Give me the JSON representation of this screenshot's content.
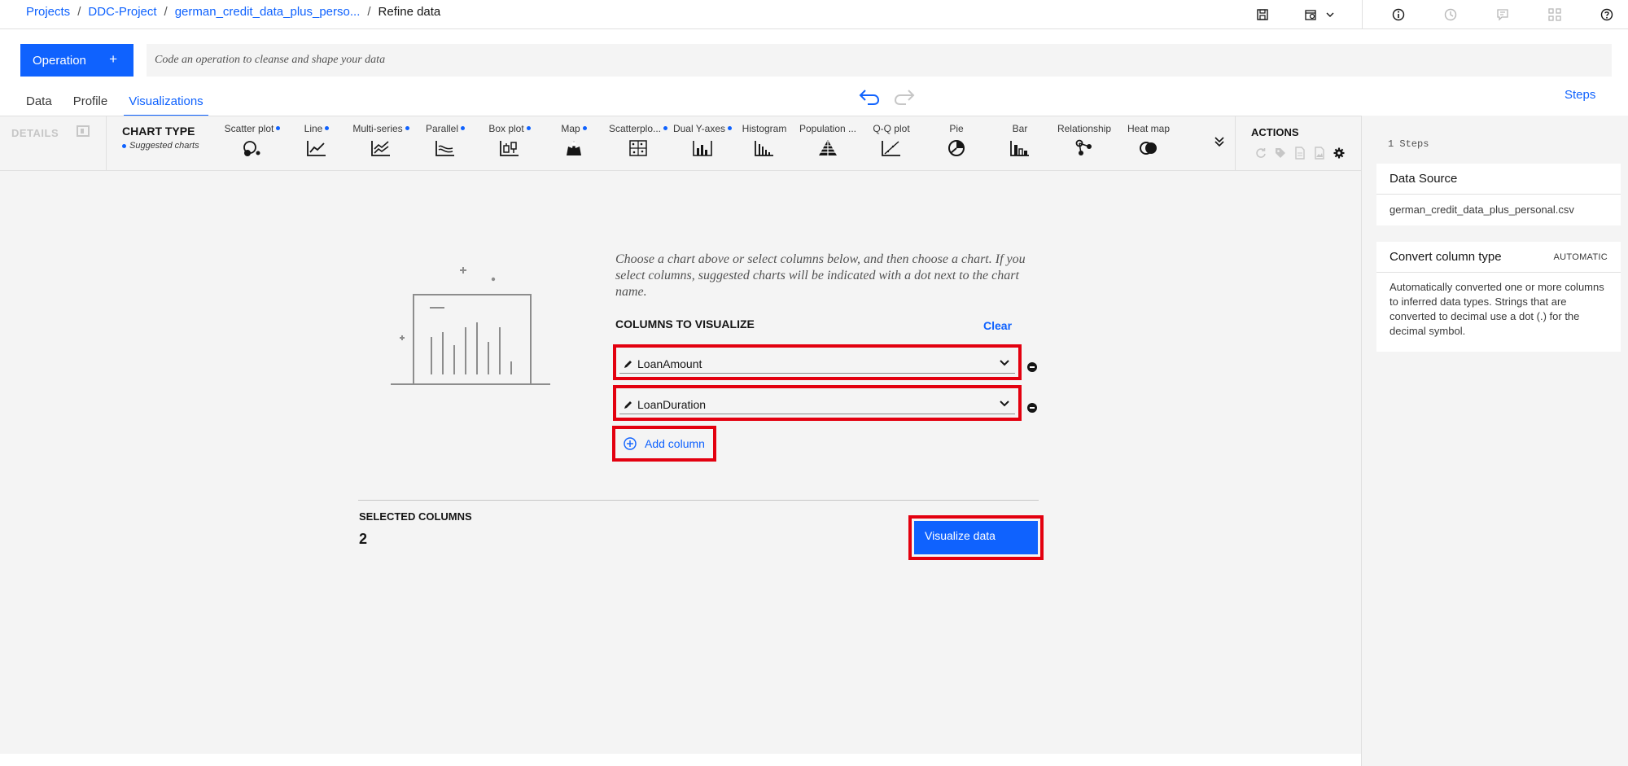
{
  "breadcrumbs": {
    "projects": "Projects",
    "project": "DDC-Project",
    "dataset": "german_credit_data_plus_perso...",
    "current": "Refine data"
  },
  "operation": {
    "button_label": "Operation",
    "plus": "+",
    "code_placeholder": "Code an operation to cleanse and shape your data"
  },
  "tabs": [
    "Data",
    "Profile",
    "Visualizations"
  ],
  "active_tab": "Visualizations",
  "steps_link": "Steps",
  "toolbar": {
    "details_label": "DETAILS",
    "chart_type_title": "CHART TYPE",
    "suggested_label": "Suggested charts",
    "charts": [
      {
        "label": "Scatter plot",
        "suggested": true,
        "icon": "scatter-plot-icon"
      },
      {
        "label": "Line",
        "suggested": true,
        "icon": "line-chart-icon"
      },
      {
        "label": "Multi-series",
        "suggested": true,
        "icon": "multi-series-icon"
      },
      {
        "label": "Parallel",
        "suggested": true,
        "icon": "parallel-icon"
      },
      {
        "label": "Box plot",
        "suggested": true,
        "icon": "box-plot-icon"
      },
      {
        "label": "Map",
        "suggested": true,
        "icon": "map-icon"
      },
      {
        "label": "Scatterplo...",
        "suggested": true,
        "icon": "scatterplot-matrix-icon"
      },
      {
        "label": "Dual Y-axes",
        "suggested": true,
        "icon": "dual-y-axes-icon"
      },
      {
        "label": "Histogram",
        "suggested": false,
        "icon": "histogram-icon"
      },
      {
        "label": "Population ...",
        "suggested": false,
        "icon": "population-pyramid-icon"
      },
      {
        "label": "Q-Q plot",
        "suggested": false,
        "icon": "qq-plot-icon"
      },
      {
        "label": "Pie",
        "suggested": false,
        "icon": "pie-chart-icon"
      },
      {
        "label": "Bar",
        "suggested": false,
        "icon": "bar-chart-icon"
      },
      {
        "label": "Relationship",
        "suggested": false,
        "icon": "relationship-icon"
      },
      {
        "label": "Heat map",
        "suggested": false,
        "icon": "heat-map-icon"
      }
    ],
    "actions_title": "ACTIONS"
  },
  "main": {
    "prompt": "Choose a chart above or select columns below, and then choose a chart. If you select columns, suggested charts will be indicated with a dot next to the chart name.",
    "columns_title": "COLUMNS TO VISUALIZE",
    "clear_label": "Clear",
    "columns": [
      "LoanAmount",
      "LoanDuration"
    ],
    "add_column_label": "Add column",
    "selected_columns_label": "SELECTED COLUMNS",
    "selected_count": "2",
    "visualize_label": "Visualize data"
  },
  "right_panel": {
    "steps_count": "1 Steps",
    "data_source_title": "Data Source",
    "data_source_file": "german_credit_data_plus_personal.csv",
    "step_title": "Convert column type",
    "step_badge": "AUTOMATIC",
    "step_description": "Automatically converted one or more columns to inferred data types. Strings that are converted to decimal use a dot (.) for the decimal symbol."
  },
  "colors": {
    "accent": "#0f62fe",
    "highlight": "#e3000f",
    "panel_bg": "#f4f4f4"
  }
}
